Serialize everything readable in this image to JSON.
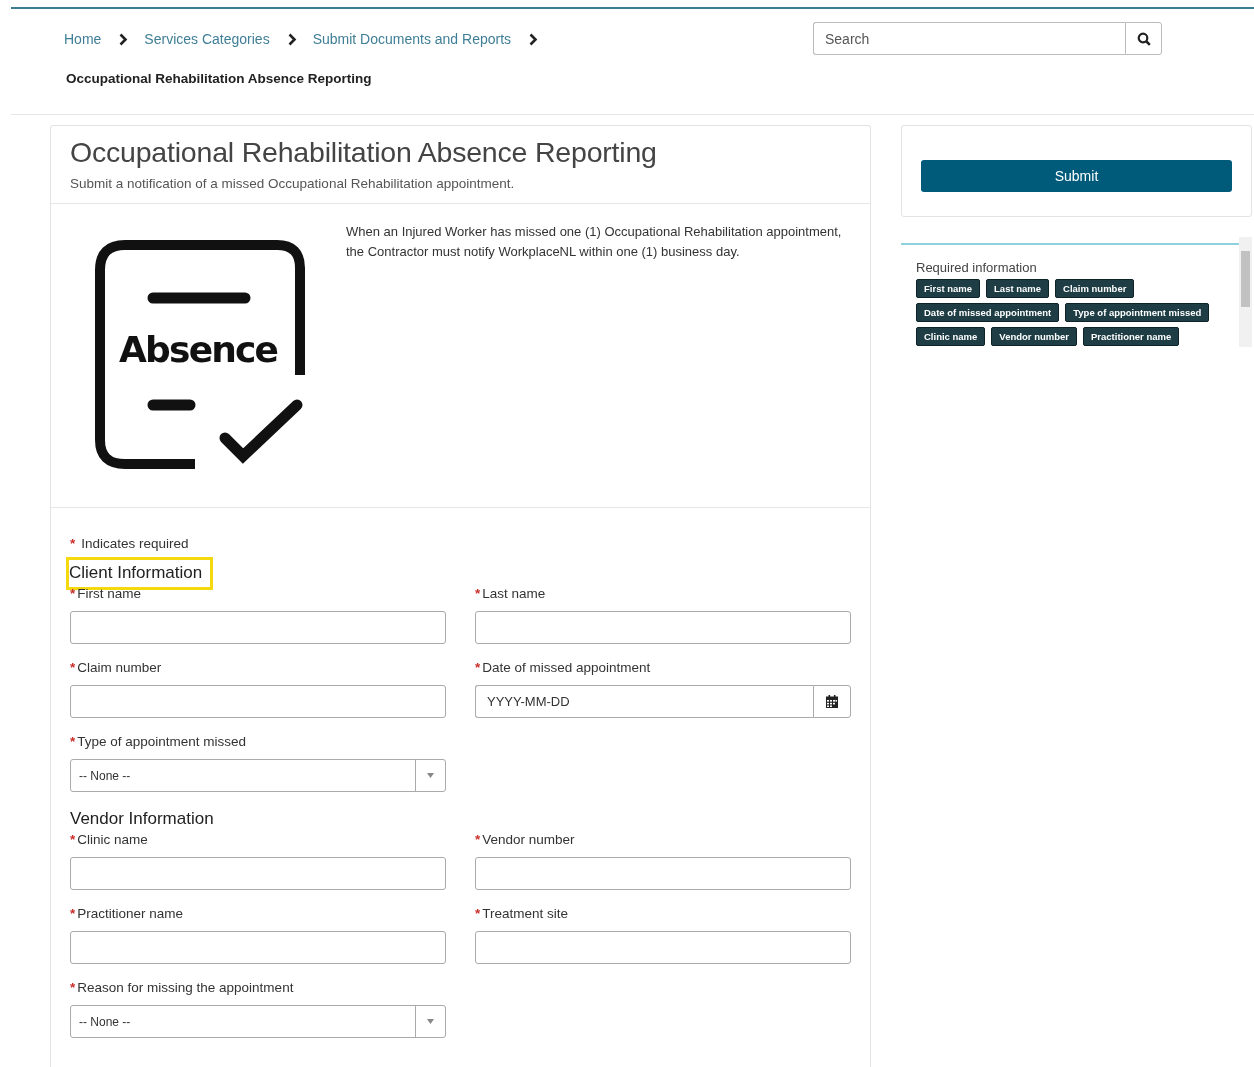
{
  "breadcrumb": {
    "items": [
      {
        "label": "Home"
      },
      {
        "label": "Services Categories"
      },
      {
        "label": "Submit Documents and Reports"
      }
    ],
    "current": "Occupational Rehabilitation Absence Reporting"
  },
  "search": {
    "placeholder": "Search"
  },
  "form_card": {
    "title": "Occupational Rehabilitation Absence Reporting",
    "subtitle": "Submit a notification of a missed Occupational Rehabilitation appointment.",
    "illustration_text": "Absence",
    "description": "When an Injured Worker has missed one (1) Occupational Rehabilitation appointment, the Contractor must notify WorkplaceNL within one (1) business day.",
    "required_note": {
      "mark": "*",
      "text": "Indicates required"
    },
    "sections": [
      {
        "title": "Client Information",
        "highlighted": true,
        "fields": [
          {
            "kind": "text",
            "label": "First name",
            "mark": "*"
          },
          {
            "kind": "text",
            "label": "Last name",
            "mark": "*"
          },
          {
            "kind": "text",
            "label": "Claim number",
            "mark": "*"
          },
          {
            "kind": "date",
            "label": "Date of missed appointment",
            "mark": "*",
            "placeholder": "YYYY-MM-DD"
          },
          {
            "kind": "select",
            "label": "Type of appointment missed",
            "mark": "*",
            "value": "-- None --"
          }
        ]
      },
      {
        "title": "Vendor Information",
        "highlighted": false,
        "fields": [
          {
            "kind": "text",
            "label": "Clinic name",
            "mark": "*"
          },
          {
            "kind": "text",
            "label": "Vendor number",
            "mark": "*"
          },
          {
            "kind": "text",
            "label": "Practitioner name",
            "mark": "*"
          },
          {
            "kind": "text",
            "label": "Treatment site",
            "mark": "*"
          },
          {
            "kind": "select",
            "label": "Reason for missing the appointment",
            "mark": "*",
            "value": "-- None --"
          }
        ]
      }
    ]
  },
  "submit_button": "Submit",
  "required_info": {
    "title": "Required information",
    "tags": [
      "First name",
      "Last name",
      "Claim number",
      "Date of missed appointment",
      "Type of appointment missed",
      "Clinic name",
      "Vendor number",
      "Practitioner name"
    ]
  }
}
